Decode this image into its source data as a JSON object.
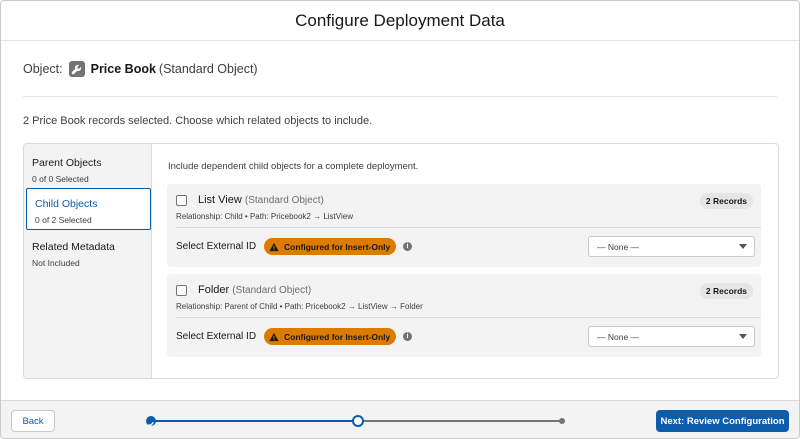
{
  "header": {
    "title": "Configure Deployment Data"
  },
  "object": {
    "label": "Object:",
    "name": "Price Book",
    "type": "(Standard Object)",
    "icon": "wrench-icon"
  },
  "selection_info": "2 Price Book records selected. Choose which related objects to include.",
  "nav": {
    "items": [
      {
        "title": "Parent Objects",
        "subtitle": "0 of 0 Selected",
        "active": false
      },
      {
        "title": "Child Objects",
        "subtitle": "0 of 2 Selected",
        "active": true
      },
      {
        "title": "Related Metadata",
        "subtitle": "Not Included",
        "active": false
      }
    ]
  },
  "content": {
    "intro": "Include dependent child objects for a complete deployment.",
    "cards": [
      {
        "title": "List View",
        "type": "(Standard Object)",
        "relationship": "Relationship: Child • Path: Pricebook2 → ListView",
        "records": "2 Records",
        "external_id_label": "Select External ID",
        "warning": "Configured for Insert-Only",
        "select_value": "— None —",
        "checked": false
      },
      {
        "title": "Folder",
        "type": "(Standard Object)",
        "relationship": "Relationship: Parent of Child • Path: Pricebook2 → ListView → Folder",
        "records": "2 Records",
        "external_id_label": "Select External ID",
        "warning": "Configured for Insert-Only",
        "select_value": "— None —",
        "checked": false
      }
    ]
  },
  "footer": {
    "back_label": "Back",
    "next_label": "Next: Review Configuration",
    "progress": {
      "steps": 3,
      "completed": 1,
      "current": 2
    }
  },
  "colors": {
    "brand": "#0b5cab",
    "warning": "#dd7a01",
    "panel_bg": "#f3f3f3",
    "border": "#dddbda"
  }
}
